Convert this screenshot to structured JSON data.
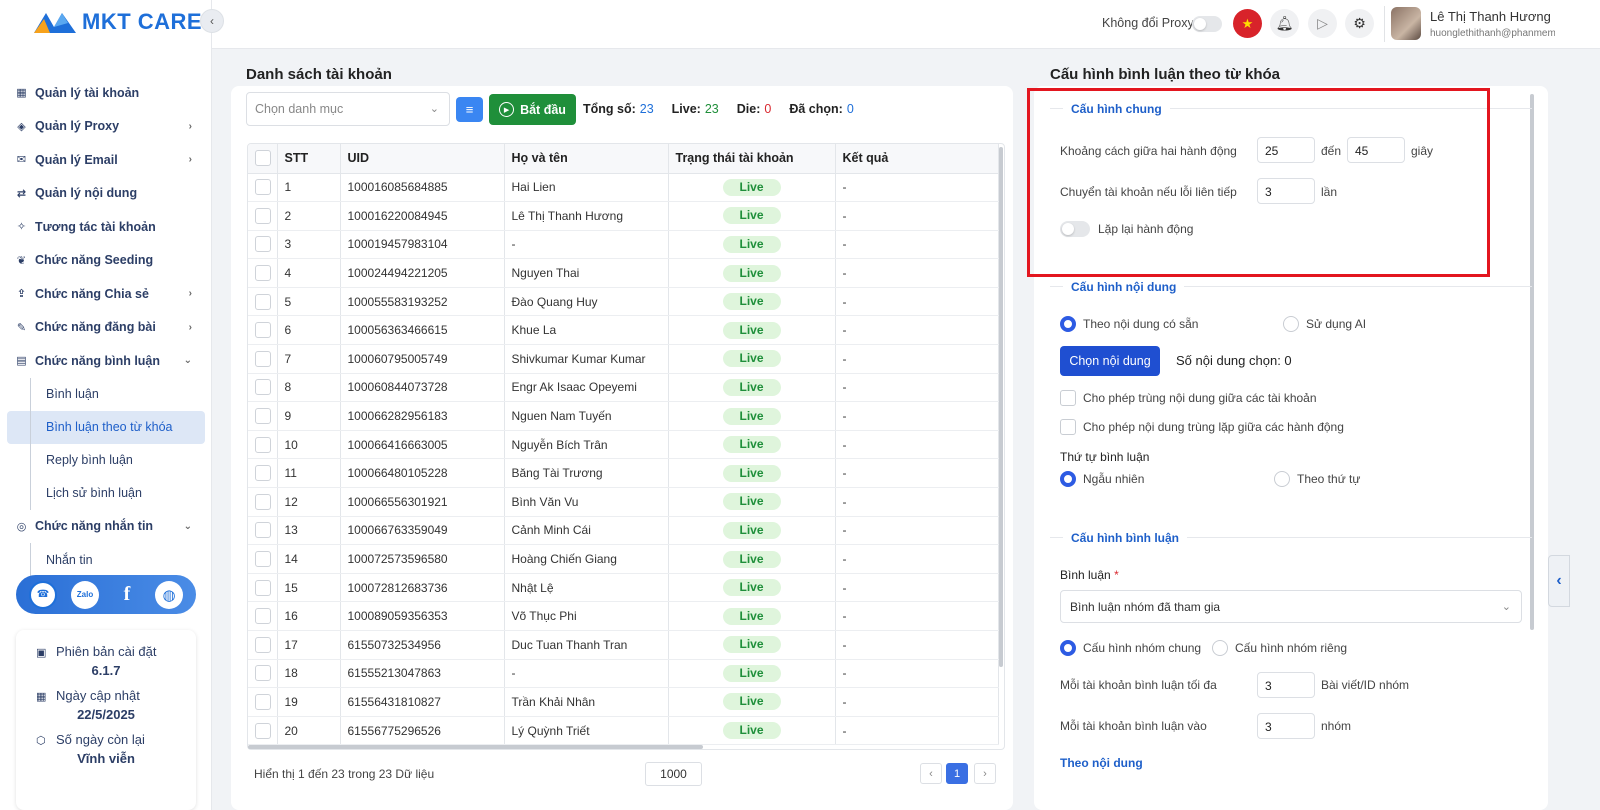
{
  "brand": {
    "name": "MKT CARE",
    "colors": {
      "primary": "#1e6fd9",
      "live_bg": "#dff5dc",
      "live_fg": "#1f8f3a",
      "highlight": "#e3161f"
    }
  },
  "sidebar": {
    "items": [
      {
        "label": "Quản lý tài khoản",
        "icon": "grid-icon",
        "chevron": ""
      },
      {
        "label": "Quản lý Proxy",
        "icon": "layers-icon",
        "chevron": "›"
      },
      {
        "label": "Quản lý Email",
        "icon": "mail-icon",
        "chevron": "›"
      },
      {
        "label": "Quản lý nội dung",
        "icon": "shuffle-icon",
        "chevron": ""
      },
      {
        "label": "Tương tác tài khoản",
        "icon": "sparkle-icon",
        "chevron": ""
      },
      {
        "label": "Chức năng Seeding",
        "icon": "seed-icon",
        "chevron": ""
      },
      {
        "label": "Chức năng Chia sẻ",
        "icon": "share-icon",
        "chevron": "›"
      },
      {
        "label": "Chức năng đăng bài",
        "icon": "edit-icon",
        "chevron": "›"
      },
      {
        "label": "Chức năng bình luận",
        "icon": "comment-icon",
        "chevron": "⌄"
      }
    ],
    "comment_sub": [
      "Bình luận",
      "Bình luận theo từ khóa",
      "Reply bình luận",
      "Lịch sử bình luận"
    ],
    "message_item": {
      "label": "Chức năng nhắn tin",
      "icon": "chat-icon",
      "chevron": "⌄"
    },
    "message_sub": [
      "Nhắn tin"
    ],
    "social": {
      "zalo": "Zalo",
      "fb": "f"
    },
    "info": {
      "version_label": "Phiên bản cài đặt",
      "version": "6.1.7",
      "update_label": "Ngày cập nhật",
      "update": "22/5/2025",
      "days_label": "Số ngày còn lại",
      "days": "Vĩnh viễn"
    }
  },
  "header": {
    "proxy_label": "Không đổi Proxy",
    "user_name": "Lê Thị Thanh Hương",
    "user_email": "huonglethithanh@phanmemmkt.vn"
  },
  "left": {
    "title": "Danh sách tài khoản",
    "category_placeholder": "Chọn danh mục",
    "start_label": "Bắt đầu",
    "stats": {
      "total_label": "Tổng số:",
      "total": "23",
      "live_label": "Live:",
      "live": "23",
      "die_label": "Die:",
      "die": "0",
      "selected_label": "Đã chọn:",
      "selected": "0"
    },
    "columns": [
      "STT",
      "UID",
      "Họ và tên",
      "Trạng thái tài khoản",
      "Kết quả"
    ],
    "rows": [
      {
        "stt": "1",
        "uid": "100016085684885",
        "name": "Hai Lien",
        "status": "Live",
        "result": "-"
      },
      {
        "stt": "2",
        "uid": "100016220084945",
        "name": "Lê Thị Thanh Hương",
        "status": "Live",
        "result": "-"
      },
      {
        "stt": "3",
        "uid": "100019457983104",
        "name": "-",
        "status": "Live",
        "result": "-"
      },
      {
        "stt": "4",
        "uid": "100024494221205",
        "name": "Nguyen Thai",
        "status": "Live",
        "result": "-"
      },
      {
        "stt": "5",
        "uid": "100055583193252",
        "name": "Đào Quang Huy",
        "status": "Live",
        "result": "-"
      },
      {
        "stt": "6",
        "uid": "100056363466615",
        "name": "Khue La",
        "status": "Live",
        "result": "-"
      },
      {
        "stt": "7",
        "uid": "100060795005749",
        "name": "Shivkumar Kumar Kumar",
        "status": "Live",
        "result": "-"
      },
      {
        "stt": "8",
        "uid": "100060844073728",
        "name": "Engr Ak Isaac Opeyemi",
        "status": "Live",
        "result": "-"
      },
      {
        "stt": "9",
        "uid": "100066282956183",
        "name": "Nguen Nam Tuyến",
        "status": "Live",
        "result": "-"
      },
      {
        "stt": "10",
        "uid": "100066416663005",
        "name": "Nguyễn Bích Trân",
        "status": "Live",
        "result": "-"
      },
      {
        "stt": "11",
        "uid": "100066480105228",
        "name": "Băng Tài Trương",
        "status": "Live",
        "result": "-"
      },
      {
        "stt": "12",
        "uid": "100066556301921",
        "name": "Bình Văn Vu",
        "status": "Live",
        "result": "-"
      },
      {
        "stt": "13",
        "uid": "100066763359049",
        "name": "Cảnh Minh Cái",
        "status": "Live",
        "result": "-"
      },
      {
        "stt": "14",
        "uid": "100072573596580",
        "name": "Hoàng Chiến Giang",
        "status": "Live",
        "result": "-"
      },
      {
        "stt": "15",
        "uid": "100072812683736",
        "name": "Nhật Lệ",
        "status": "Live",
        "result": "-"
      },
      {
        "stt": "16",
        "uid": "100089059356353",
        "name": "Võ Thục Phi",
        "status": "Live",
        "result": "-"
      },
      {
        "stt": "17",
        "uid": "61550732534956",
        "name": "Duc Tuan Thanh Tran",
        "status": "Live",
        "result": "-"
      },
      {
        "stt": "18",
        "uid": "61555213047863",
        "name": "-",
        "status": "Live",
        "result": "-"
      },
      {
        "stt": "19",
        "uid": "61556431810827",
        "name": "Trần Khải Nhân",
        "status": "Live",
        "result": "-"
      },
      {
        "stt": "20",
        "uid": "61556775296526",
        "name": "Lý Quỳnh Triết",
        "status": "Live",
        "result": "-"
      }
    ],
    "footer": "Hiển thị 1 đến 23 trong 23 Dữ liệu",
    "page_size": "1000",
    "page": "1"
  },
  "right": {
    "title": "Cấu hình bình luận theo từ khóa",
    "general": {
      "legend": "Cấu hình chung",
      "gap_label": "Khoảng cách giữa hai hành động",
      "gap_from": "25",
      "gap_to_label": "đến",
      "gap_to": "45",
      "gap_unit": "giây",
      "switch_label": "Chuyển tài khoản nếu lỗi liên tiếp",
      "switch_value": "3",
      "switch_unit": "lần",
      "repeat_label": "Lặp lại hành động"
    },
    "content": {
      "legend": "Cấu hình nội dung",
      "opt_existing": "Theo nội dung có sẵn",
      "opt_ai": "Sử dụng AI",
      "choose_btn": "Chọn nội dung",
      "count": "Số nội dung chọn: 0",
      "allow_dup_accounts": "Cho phép trùng nội dung giữa các tài khoản",
      "allow_dup_actions": "Cho phép nội dung trùng lặp giữa các hành động",
      "order_label": "Thứ tự bình luận",
      "order_random": "Ngẫu nhiên",
      "order_seq": "Theo thứ tự"
    },
    "comment": {
      "legend": "Cấu hình bình luận",
      "comment_label": "Bình luận",
      "required_mark": "*",
      "comment_select": "Bình luận nhóm đã tham gia",
      "opt_common": "Cấu hình nhóm chung",
      "opt_private": "Cấu hình nhóm riêng",
      "max_label": "Mỗi tài khoản bình luận tối đa",
      "max_value": "3",
      "max_unit": "Bài viết/ID nhóm",
      "into_label": "Mỗi tài khoản bình luận vào",
      "into_value": "3",
      "into_unit": "nhóm",
      "content_title": "Theo nội dung"
    }
  }
}
